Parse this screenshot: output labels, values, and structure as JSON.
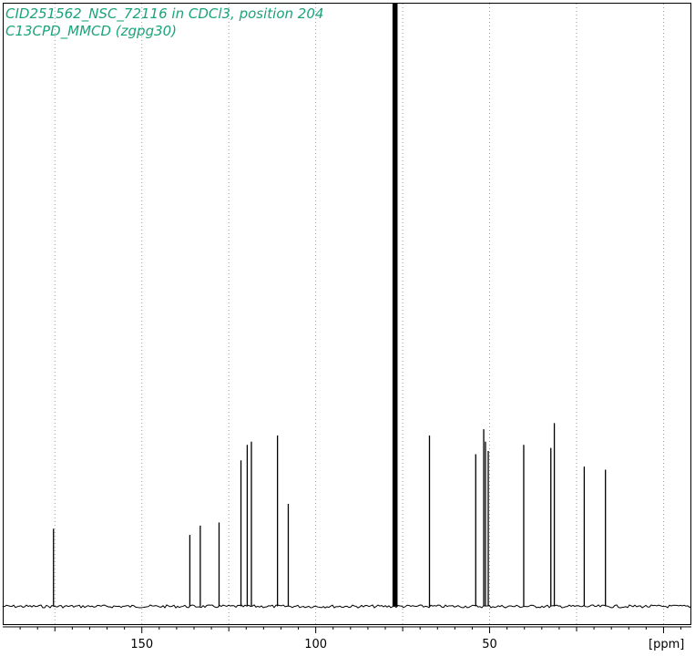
{
  "chart_data": {
    "type": "line",
    "title_lines": [
      "CID251562_NSC_72116 in CDCl3, position 204",
      "C13CPD_MMCD (zgpg30)"
    ],
    "xlabel": "[ppm]",
    "x_reversed": true,
    "xlim": [
      190,
      -8
    ],
    "ylim": [
      0,
      1
    ],
    "x_ticks": [
      150,
      100,
      50
    ],
    "grid": "vertical dotted",
    "baseline": 0.03,
    "series": [
      {
        "peaks": [
          {
            "ppm": 175.4,
            "height": 0.155
          },
          {
            "ppm": 136.2,
            "height": 0.145
          },
          {
            "ppm": 133.2,
            "height": 0.16
          },
          {
            "ppm": 127.8,
            "height": 0.165
          },
          {
            "ppm": 121.5,
            "height": 0.265
          },
          {
            "ppm": 119.7,
            "height": 0.29
          },
          {
            "ppm": 118.5,
            "height": 0.295
          },
          {
            "ppm": 111.0,
            "height": 0.305
          },
          {
            "ppm": 107.9,
            "height": 0.195
          },
          {
            "ppm": 77.6,
            "height": 1.0
          },
          {
            "ppm": 77.2,
            "height": 1.0
          },
          {
            "ppm": 76.8,
            "height": 1.0
          },
          {
            "ppm": 67.3,
            "height": 0.305
          },
          {
            "ppm": 54.0,
            "height": 0.275
          },
          {
            "ppm": 51.7,
            "height": 0.315
          },
          {
            "ppm": 51.2,
            "height": 0.295
          },
          {
            "ppm": 50.4,
            "height": 0.28
          },
          {
            "ppm": 40.2,
            "height": 0.29
          },
          {
            "ppm": 32.4,
            "height": 0.285
          },
          {
            "ppm": 31.4,
            "height": 0.325
          },
          {
            "ppm": 22.8,
            "height": 0.255
          },
          {
            "ppm": 16.7,
            "height": 0.25
          }
        ]
      }
    ]
  }
}
